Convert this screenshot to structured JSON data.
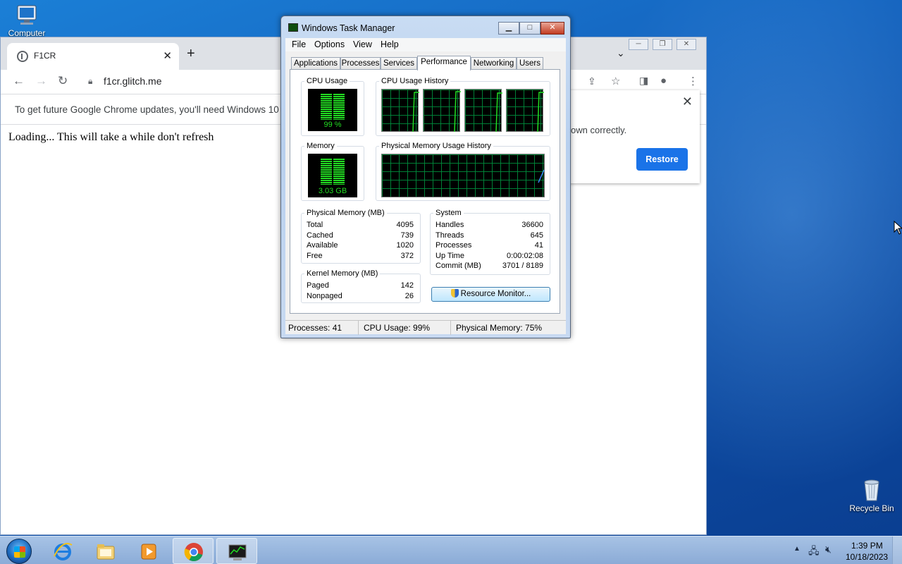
{
  "desktop": {
    "icons": [
      {
        "label": "Computer"
      },
      {
        "label": "Recycle Bin"
      }
    ]
  },
  "chrome": {
    "tab_title": "F1CR",
    "tab_close": "✕",
    "new_tab": "+",
    "url": "f1cr.glitch.me",
    "infobar_message": "To get future Google Chrome updates, you'll need Windows 10 or",
    "restore_message": "own correctly.",
    "restore_button": "Restore",
    "page_text": "Loading... This will take a while don't refresh"
  },
  "task_manager": {
    "title": "Windows Task Manager",
    "menu": [
      "File",
      "Options",
      "View",
      "Help"
    ],
    "tabs": [
      "Applications",
      "Processes",
      "Services",
      "Performance",
      "Networking",
      "Users"
    ],
    "active_tab": "Performance",
    "cpu_usage": {
      "label": "CPU Usage",
      "value": "99 %"
    },
    "cpu_history": {
      "label": "CPU Usage History",
      "core_count": 4
    },
    "memory": {
      "label": "Memory",
      "value": "3.03 GB"
    },
    "memory_history": {
      "label": "Physical Memory Usage History"
    },
    "physical_memory": {
      "label": "Physical Memory (MB)",
      "rows": [
        {
          "key": "Total",
          "value": "4095"
        },
        {
          "key": "Cached",
          "value": "739"
        },
        {
          "key": "Available",
          "value": "1020"
        },
        {
          "key": "Free",
          "value": "372"
        }
      ]
    },
    "system": {
      "label": "System",
      "rows": [
        {
          "key": "Handles",
          "value": "36600"
        },
        {
          "key": "Threads",
          "value": "645"
        },
        {
          "key": "Processes",
          "value": "41"
        },
        {
          "key": "Up Time",
          "value": "0:00:02:08"
        },
        {
          "key": "Commit (MB)",
          "value": "3701 / 8189"
        }
      ]
    },
    "kernel_memory": {
      "label": "Kernel Memory (MB)",
      "rows": [
        {
          "key": "Paged",
          "value": "142"
        },
        {
          "key": "Nonpaged",
          "value": "26"
        }
      ]
    },
    "resource_monitor_button": "Resource Monitor...",
    "status": {
      "processes": "Processes: 41",
      "cpu": "CPU Usage: 99%",
      "memory": "Physical Memory: 75%"
    }
  },
  "taskbar": {
    "time": "1:39 PM",
    "date": "10/18/2023",
    "pinned": [
      "internet-explorer-icon",
      "explorer-folder-icon",
      "media-player-icon",
      "chrome-icon",
      "task-manager-icon"
    ]
  },
  "colors": {
    "meter_green": "#22dd22",
    "grid_green": "#008c3c",
    "restore_blue": "#1a73e8"
  }
}
